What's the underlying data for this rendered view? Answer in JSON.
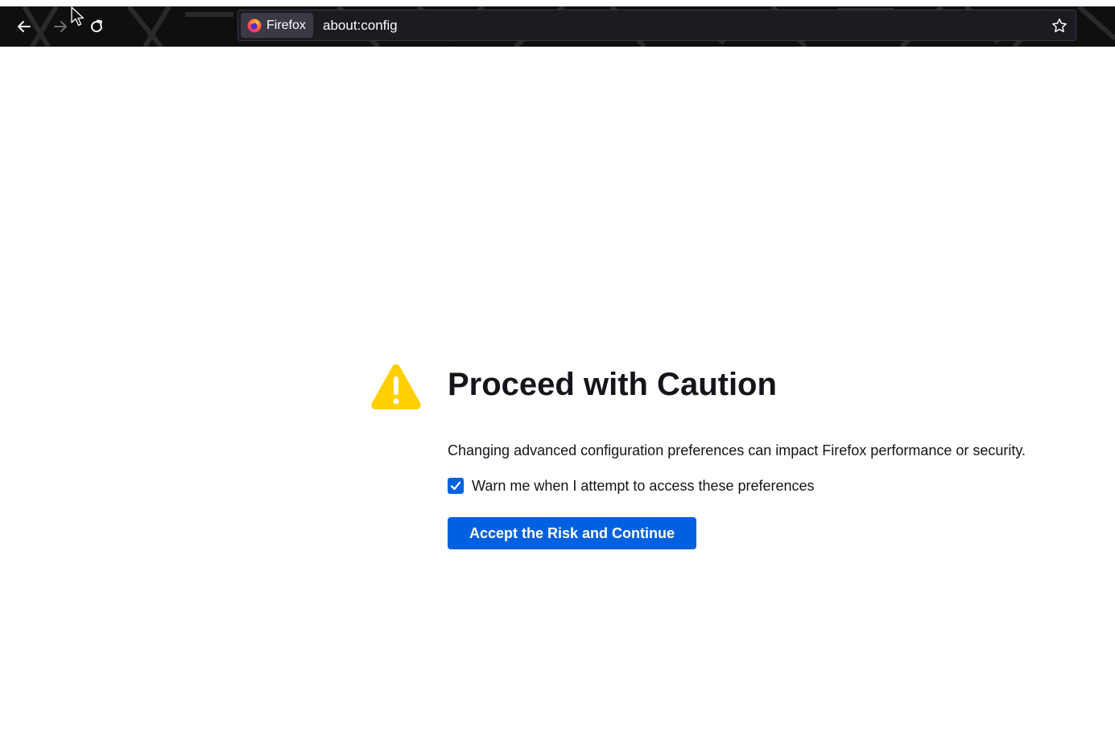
{
  "browser": {
    "identity_label": "Firefox",
    "url": "about:config",
    "icons": {
      "back": "back-arrow-icon",
      "forward": "forward-arrow-icon",
      "reload": "reload-icon",
      "bookmark": "star-icon",
      "browser_logo": "firefox-logo-icon"
    },
    "colors": {
      "toolbar": "#0f0f0f",
      "urlbar": "#1c1b22",
      "identity_box": "#3a3944",
      "text": "#fbfbfe"
    }
  },
  "page": {
    "title": "Proceed with Caution",
    "description": "Changing advanced configuration preferences can impact Firefox performance or security.",
    "warn_checkbox": {
      "label": "Warn me when I attempt to access these preferences",
      "checked": true
    },
    "accept_button_label": "Accept the Risk and Continue",
    "icon": "warning-icon",
    "colors": {
      "accent": "#0061e0",
      "warning": "#ffd000",
      "text": "#15141a"
    }
  }
}
